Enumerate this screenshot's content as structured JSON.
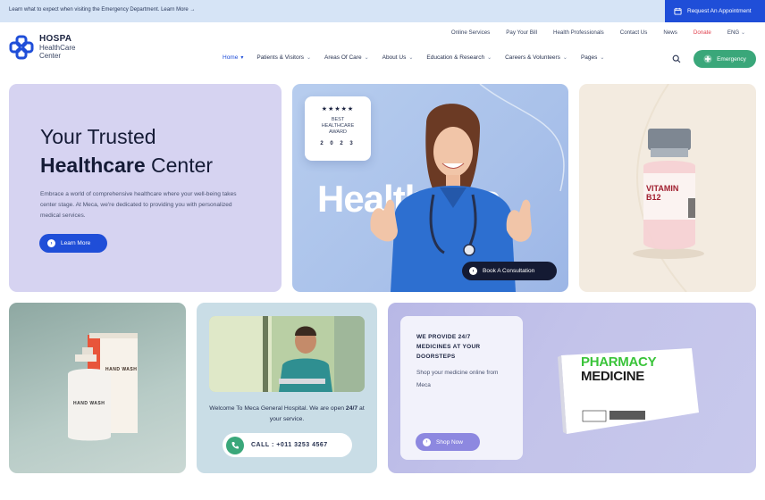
{
  "topbar": {
    "notice": "Learn what to expect when visiting the Emergency Department. Learn More →",
    "appointment_label": "Request An Appointment"
  },
  "brand": {
    "name": "HOSPA",
    "line2": "HealthCare",
    "line3": "Center"
  },
  "utility_nav": [
    "Online Services",
    "Pay Your Bill",
    "Health Professionals",
    "Contact Us",
    "News",
    "Donate",
    "ENG"
  ],
  "main_nav": [
    {
      "label": "Home"
    },
    {
      "label": "Patients & Visitors"
    },
    {
      "label": "Areas Of Care"
    },
    {
      "label": "About Us"
    },
    {
      "label": "Education & Research"
    },
    {
      "label": "Careers & Volunteers"
    },
    {
      "label": "Pages"
    }
  ],
  "emergency_label": "Emergency",
  "hero": {
    "title_line1": "Your Trusted",
    "title_bold": "Healthcare",
    "title_rest": " Center",
    "description": "Embrace a world of comprehensive healthcare where your well-being takes center stage. At Meca, we're dedicated to providing you with personalized medical services.",
    "cta": "Learn More"
  },
  "feature": {
    "watermark": "Healthcare",
    "award_stars": "★★★★★",
    "award_line1": "BEST",
    "award_line2": "HEALTHCARE",
    "award_line3": "AWARD",
    "award_year": "2 0 2 3",
    "consult_label": "Book A Consultation"
  },
  "vial": {
    "label_line1": "VITAMIN",
    "label_line2": "B12"
  },
  "handwash": {
    "label": "HAND WASH"
  },
  "meca": {
    "msg_before": "Welcome To Meca General Hospital. We are open ",
    "msg_bold": "24/7",
    "msg_after": " at your service.",
    "call_label": "CALL : +011 3253 4567"
  },
  "pharmacy": {
    "heading": "WE PROVIDE 24/7 MEDICINES AT YOUR DOORSTEPS",
    "sub": "Shop your medicine online from Meca",
    "cta": "Shop Now",
    "box_line1": "PHARMACY",
    "box_line2": "MEDICINE"
  },
  "colors": {
    "accent": "#1f4ed8",
    "emergency": "#3aa77a",
    "donate": "#e0404d",
    "hero_bg": "#d6d3f1",
    "pharmacy_bg": "#c3c3ea"
  }
}
